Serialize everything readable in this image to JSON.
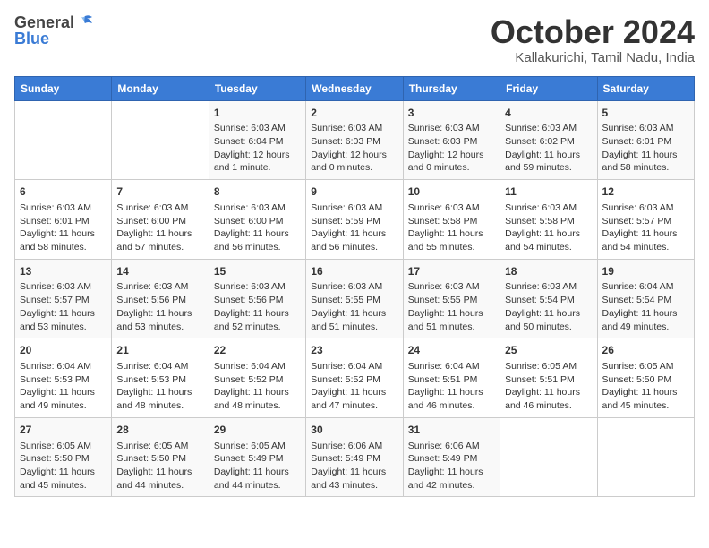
{
  "logo": {
    "general": "General",
    "blue": "Blue"
  },
  "header": {
    "month": "October 2024",
    "location": "Kallakurichi, Tamil Nadu, India"
  },
  "weekdays": [
    "Sunday",
    "Monday",
    "Tuesday",
    "Wednesday",
    "Thursday",
    "Friday",
    "Saturday"
  ],
  "weeks": [
    [
      {
        "day": "",
        "info": ""
      },
      {
        "day": "",
        "info": ""
      },
      {
        "day": "1",
        "info": "Sunrise: 6:03 AM\nSunset: 6:04 PM\nDaylight: 12 hours\nand 1 minute."
      },
      {
        "day": "2",
        "info": "Sunrise: 6:03 AM\nSunset: 6:03 PM\nDaylight: 12 hours\nand 0 minutes."
      },
      {
        "day": "3",
        "info": "Sunrise: 6:03 AM\nSunset: 6:03 PM\nDaylight: 12 hours\nand 0 minutes."
      },
      {
        "day": "4",
        "info": "Sunrise: 6:03 AM\nSunset: 6:02 PM\nDaylight: 11 hours\nand 59 minutes."
      },
      {
        "day": "5",
        "info": "Sunrise: 6:03 AM\nSunset: 6:01 PM\nDaylight: 11 hours\nand 58 minutes."
      }
    ],
    [
      {
        "day": "6",
        "info": "Sunrise: 6:03 AM\nSunset: 6:01 PM\nDaylight: 11 hours\nand 58 minutes."
      },
      {
        "day": "7",
        "info": "Sunrise: 6:03 AM\nSunset: 6:00 PM\nDaylight: 11 hours\nand 57 minutes."
      },
      {
        "day": "8",
        "info": "Sunrise: 6:03 AM\nSunset: 6:00 PM\nDaylight: 11 hours\nand 56 minutes."
      },
      {
        "day": "9",
        "info": "Sunrise: 6:03 AM\nSunset: 5:59 PM\nDaylight: 11 hours\nand 56 minutes."
      },
      {
        "day": "10",
        "info": "Sunrise: 6:03 AM\nSunset: 5:58 PM\nDaylight: 11 hours\nand 55 minutes."
      },
      {
        "day": "11",
        "info": "Sunrise: 6:03 AM\nSunset: 5:58 PM\nDaylight: 11 hours\nand 54 minutes."
      },
      {
        "day": "12",
        "info": "Sunrise: 6:03 AM\nSunset: 5:57 PM\nDaylight: 11 hours\nand 54 minutes."
      }
    ],
    [
      {
        "day": "13",
        "info": "Sunrise: 6:03 AM\nSunset: 5:57 PM\nDaylight: 11 hours\nand 53 minutes."
      },
      {
        "day": "14",
        "info": "Sunrise: 6:03 AM\nSunset: 5:56 PM\nDaylight: 11 hours\nand 53 minutes."
      },
      {
        "day": "15",
        "info": "Sunrise: 6:03 AM\nSunset: 5:56 PM\nDaylight: 11 hours\nand 52 minutes."
      },
      {
        "day": "16",
        "info": "Sunrise: 6:03 AM\nSunset: 5:55 PM\nDaylight: 11 hours\nand 51 minutes."
      },
      {
        "day": "17",
        "info": "Sunrise: 6:03 AM\nSunset: 5:55 PM\nDaylight: 11 hours\nand 51 minutes."
      },
      {
        "day": "18",
        "info": "Sunrise: 6:03 AM\nSunset: 5:54 PM\nDaylight: 11 hours\nand 50 minutes."
      },
      {
        "day": "19",
        "info": "Sunrise: 6:04 AM\nSunset: 5:54 PM\nDaylight: 11 hours\nand 49 minutes."
      }
    ],
    [
      {
        "day": "20",
        "info": "Sunrise: 6:04 AM\nSunset: 5:53 PM\nDaylight: 11 hours\nand 49 minutes."
      },
      {
        "day": "21",
        "info": "Sunrise: 6:04 AM\nSunset: 5:53 PM\nDaylight: 11 hours\nand 48 minutes."
      },
      {
        "day": "22",
        "info": "Sunrise: 6:04 AM\nSunset: 5:52 PM\nDaylight: 11 hours\nand 48 minutes."
      },
      {
        "day": "23",
        "info": "Sunrise: 6:04 AM\nSunset: 5:52 PM\nDaylight: 11 hours\nand 47 minutes."
      },
      {
        "day": "24",
        "info": "Sunrise: 6:04 AM\nSunset: 5:51 PM\nDaylight: 11 hours\nand 46 minutes."
      },
      {
        "day": "25",
        "info": "Sunrise: 6:05 AM\nSunset: 5:51 PM\nDaylight: 11 hours\nand 46 minutes."
      },
      {
        "day": "26",
        "info": "Sunrise: 6:05 AM\nSunset: 5:50 PM\nDaylight: 11 hours\nand 45 minutes."
      }
    ],
    [
      {
        "day": "27",
        "info": "Sunrise: 6:05 AM\nSunset: 5:50 PM\nDaylight: 11 hours\nand 45 minutes."
      },
      {
        "day": "28",
        "info": "Sunrise: 6:05 AM\nSunset: 5:50 PM\nDaylight: 11 hours\nand 44 minutes."
      },
      {
        "day": "29",
        "info": "Sunrise: 6:05 AM\nSunset: 5:49 PM\nDaylight: 11 hours\nand 44 minutes."
      },
      {
        "day": "30",
        "info": "Sunrise: 6:06 AM\nSunset: 5:49 PM\nDaylight: 11 hours\nand 43 minutes."
      },
      {
        "day": "31",
        "info": "Sunrise: 6:06 AM\nSunset: 5:49 PM\nDaylight: 11 hours\nand 42 minutes."
      },
      {
        "day": "",
        "info": ""
      },
      {
        "day": "",
        "info": ""
      }
    ]
  ]
}
